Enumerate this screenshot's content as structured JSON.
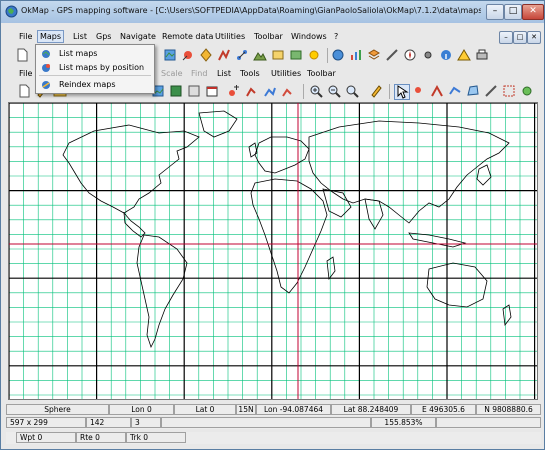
{
  "window": {
    "title": "OkMap - GPS mapping software - [C:\\Users\\SOFTPEDIA\\AppData\\Roaming\\GianPaoloSaliola\\OkMap\\7.1.2\\data\\maps\\demoLonlat.gif.o...",
    "controls": {
      "minimize": "–",
      "restore": "□",
      "close": "✕"
    },
    "inner_controls": {
      "minimize": "–",
      "restore": "□",
      "close": "✕"
    }
  },
  "menubar": [
    "File",
    "Maps",
    "List",
    "Gps",
    "Navigate",
    "Remote data",
    "Utilities",
    "Toolbar",
    "Windows",
    "?"
  ],
  "maps_menu": [
    "List maps",
    "List maps by position",
    "Reindex maps"
  ],
  "map_menubar": [
    "File",
    "Scale",
    "Find",
    "List",
    "Tools",
    "Utilities",
    "Toolbar"
  ],
  "status": {
    "datum": "Sphere",
    "lon0": "Lon 0",
    "lat0": "Lat 0",
    "zone": "15N",
    "lon": "Lon -94.087464",
    "lat": "Lat 88.248409",
    "east": "E 496305.6",
    "north": "N 9808880.6",
    "size": "597 x 299",
    "px": "142",
    "py": "3",
    "zoom": "155.853%",
    "wpt": "Wpt 0",
    "rte": "Rte 0",
    "trk": "Trk 0"
  },
  "colors": {
    "grid_minor": "#00c07a",
    "grid_major": "#000000",
    "axis": "#c00030",
    "coast": "#000000"
  }
}
